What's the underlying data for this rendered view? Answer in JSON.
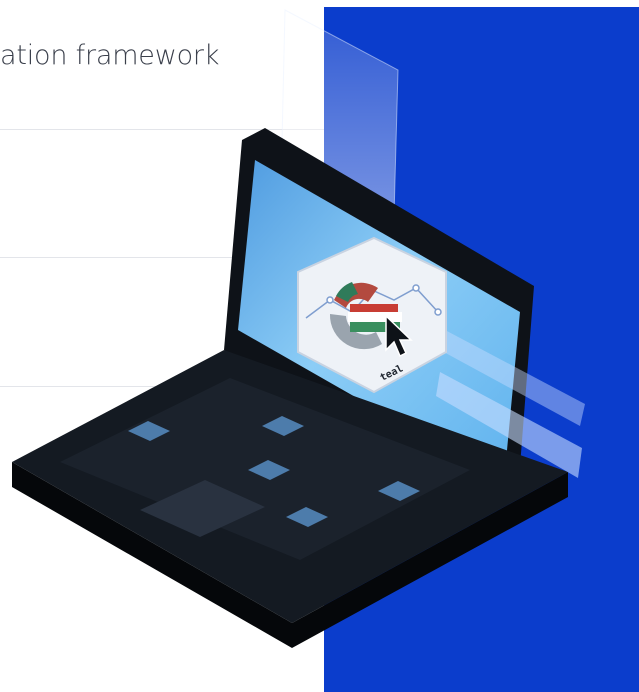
{
  "page": {
    "heading": "ation framework"
  },
  "illustration": {
    "logo_text": "teal",
    "icons": [
      "laptop-icon",
      "teal-logo-icon",
      "cursor-arrow-icon"
    ]
  },
  "colors": {
    "accent_blue": "#0b3dcc",
    "laptop_body": "#0e1218",
    "screen_glow": "#7fc3f3",
    "key_color": "#4d7cab"
  }
}
